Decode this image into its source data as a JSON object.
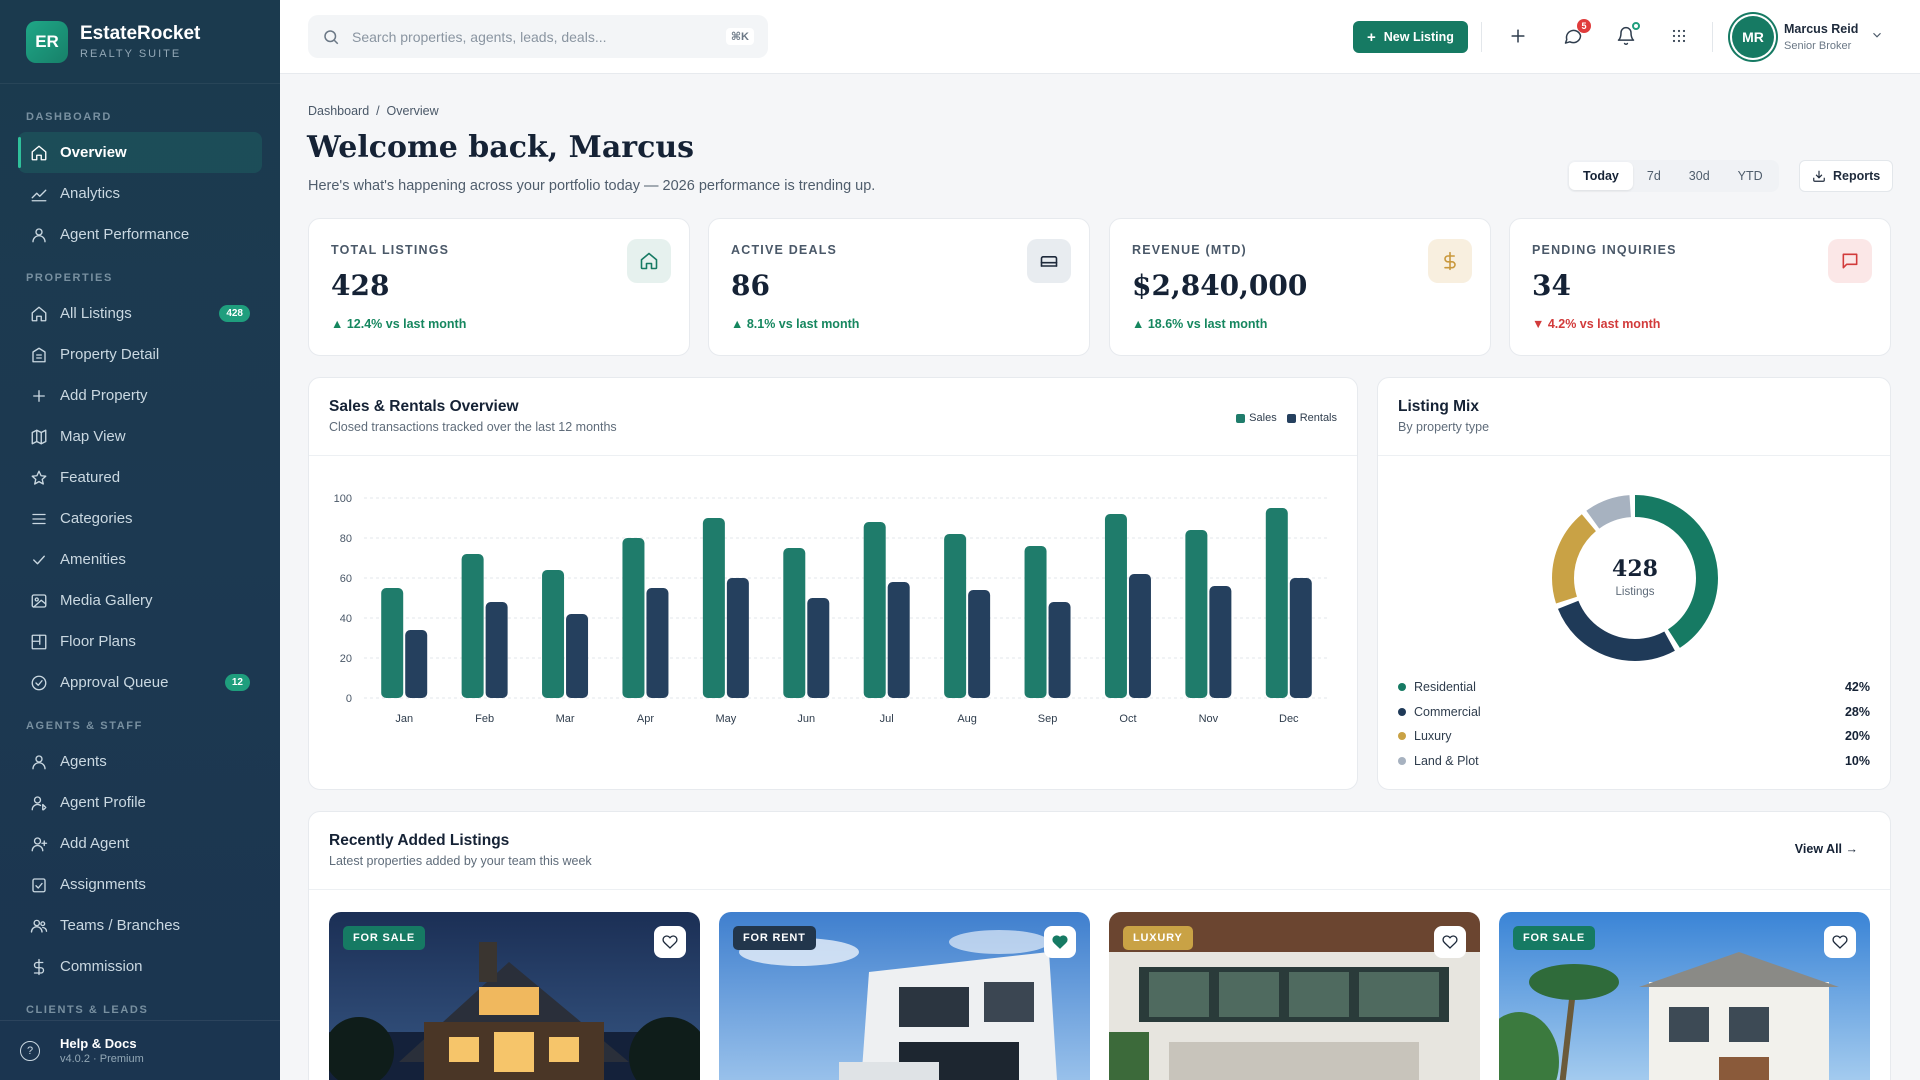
{
  "brand": {
    "initials": "ER",
    "name": "EstateRocket",
    "sub": "REALTY SUITE"
  },
  "sidebar": {
    "sections": [
      {
        "title": "DASHBOARD",
        "items": [
          {
            "label": "Overview",
            "icon": "home-icon",
            "active": true
          },
          {
            "label": "Analytics",
            "icon": "chart-line-icon"
          },
          {
            "label": "Agent Performance",
            "icon": "user-icon"
          }
        ]
      },
      {
        "title": "PROPERTIES",
        "items": [
          {
            "label": "All Listings",
            "icon": "home-icon",
            "badge": "428"
          },
          {
            "label": "Property Detail",
            "icon": "building-icon"
          },
          {
            "label": "Add Property",
            "icon": "plus-icon"
          },
          {
            "label": "Map View",
            "icon": "map-icon"
          },
          {
            "label": "Featured",
            "icon": "star-icon"
          },
          {
            "label": "Categories",
            "icon": "list-icon"
          },
          {
            "label": "Amenities",
            "icon": "check-icon"
          },
          {
            "label": "Media Gallery",
            "icon": "image-icon"
          },
          {
            "label": "Floor Plans",
            "icon": "floorplan-icon"
          },
          {
            "label": "Approval Queue",
            "icon": "check-circle-icon",
            "badge": "12"
          }
        ]
      },
      {
        "title": "AGENTS & STAFF",
        "items": [
          {
            "label": "Agents",
            "icon": "user-icon"
          },
          {
            "label": "Agent Profile",
            "icon": "user-edit-icon"
          },
          {
            "label": "Add Agent",
            "icon": "user-plus-icon"
          },
          {
            "label": "Assignments",
            "icon": "clipboard-check-icon"
          },
          {
            "label": "Teams / Branches",
            "icon": "users-icon"
          },
          {
            "label": "Commission",
            "icon": "dollar-icon"
          }
        ]
      },
      {
        "title": "CLIENTS & LEADS",
        "items": []
      }
    ],
    "footer": {
      "title": "Help & Docs",
      "sub": "v4.0.2 · Premium"
    }
  },
  "topbar": {
    "search_placeholder": "Search properties, agents, leads, deals...",
    "search_shortcut": "⌘K",
    "new_listing": "New Listing",
    "messages_count": "5",
    "user": {
      "initials": "MR",
      "name": "Marcus Reid",
      "role": "Senior Broker"
    }
  },
  "page": {
    "breadcrumb": "Dashboard  /  Overview",
    "title": "Welcome back, Marcus",
    "subtitle": "Here's what's happening across your portfolio today — 2026 performance is trending up.",
    "ranges": [
      "Today",
      "7d",
      "30d",
      "YTD"
    ],
    "active_range": "Today",
    "reports": "Reports"
  },
  "kpis": [
    {
      "label": "TOTAL LISTINGS",
      "value": "428",
      "delta": "▲ 12.4% vs last month",
      "trend": "up",
      "icon": "home-icon",
      "icon_bg": "#e6f1ee",
      "icon_color": "#167a63"
    },
    {
      "label": "ACTIVE DEALS",
      "value": "86",
      "delta": "▲ 8.1% vs last month",
      "trend": "up",
      "icon": "bed-icon",
      "icon_bg": "#e8ecf0",
      "icon_color": "#1e2a3b"
    },
    {
      "label": "REVENUE (MTD)",
      "value": "$2,840,000",
      "delta": "▲ 18.6% vs last month",
      "trend": "up",
      "icon": "dollar-icon",
      "icon_bg": "#f8efdf",
      "icon_color": "#c9983c"
    },
    {
      "label": "PENDING INQUIRIES",
      "value": "34",
      "delta": "▼ 4.2% vs last month",
      "trend": "down",
      "icon": "message-icon",
      "icon_bg": "#fbe7e7",
      "icon_color": "#d23b3b"
    }
  ],
  "sales_chart": {
    "title": "Sales & Rentals Overview",
    "subtitle": "Closed transactions tracked over the last 12 months"
  },
  "chart_data": {
    "type": "bar",
    "categories": [
      "Jan",
      "Feb",
      "Mar",
      "Apr",
      "May",
      "Jun",
      "Jul",
      "Aug",
      "Sep",
      "Oct",
      "Nov",
      "Dec"
    ],
    "series": [
      {
        "name": "Sales",
        "color": "#1f7c6b",
        "values": [
          55,
          72,
          64,
          80,
          90,
          75,
          88,
          82,
          76,
          92,
          84,
          95
        ]
      },
      {
        "name": "Rentals",
        "color": "#25405e",
        "values": [
          34,
          48,
          42,
          55,
          60,
          50,
          58,
          54,
          48,
          62,
          56,
          60
        ]
      }
    ],
    "ylim": [
      0,
      100
    ],
    "yticks": [
      0,
      20,
      40,
      60,
      80,
      100
    ],
    "grid": true,
    "legend": "top-right"
  },
  "mix": {
    "title": "Listing Mix",
    "subtitle": "By property type",
    "center_value": "428",
    "center_label": "Listings",
    "items": [
      {
        "label": "Residential",
        "value": "42%",
        "pct": 42,
        "color": "#167a63"
      },
      {
        "label": "Commercial",
        "value": "28%",
        "pct": 28,
        "color": "#1f3a58"
      },
      {
        "label": "Luxury",
        "value": "20%",
        "pct": 20,
        "color": "#c9a245"
      },
      {
        "label": "Land & Plot",
        "value": "10%",
        "pct": 10,
        "color": "#a7b2c0"
      }
    ]
  },
  "recent": {
    "title": "Recently Added Listings",
    "subtitle": "Latest properties added by your team this week",
    "view_all": "View All →",
    "cards": [
      {
        "tag": "FOR SALE",
        "tag_color": "#167a63",
        "favorited": false
      },
      {
        "tag": "FOR RENT",
        "tag_color": "#22364c",
        "favorited": true
      },
      {
        "tag": "LUXURY",
        "tag_color": "#c9a245",
        "favorited": false
      },
      {
        "tag": "FOR SALE",
        "tag_color": "#167a63",
        "favorited": false
      }
    ]
  }
}
